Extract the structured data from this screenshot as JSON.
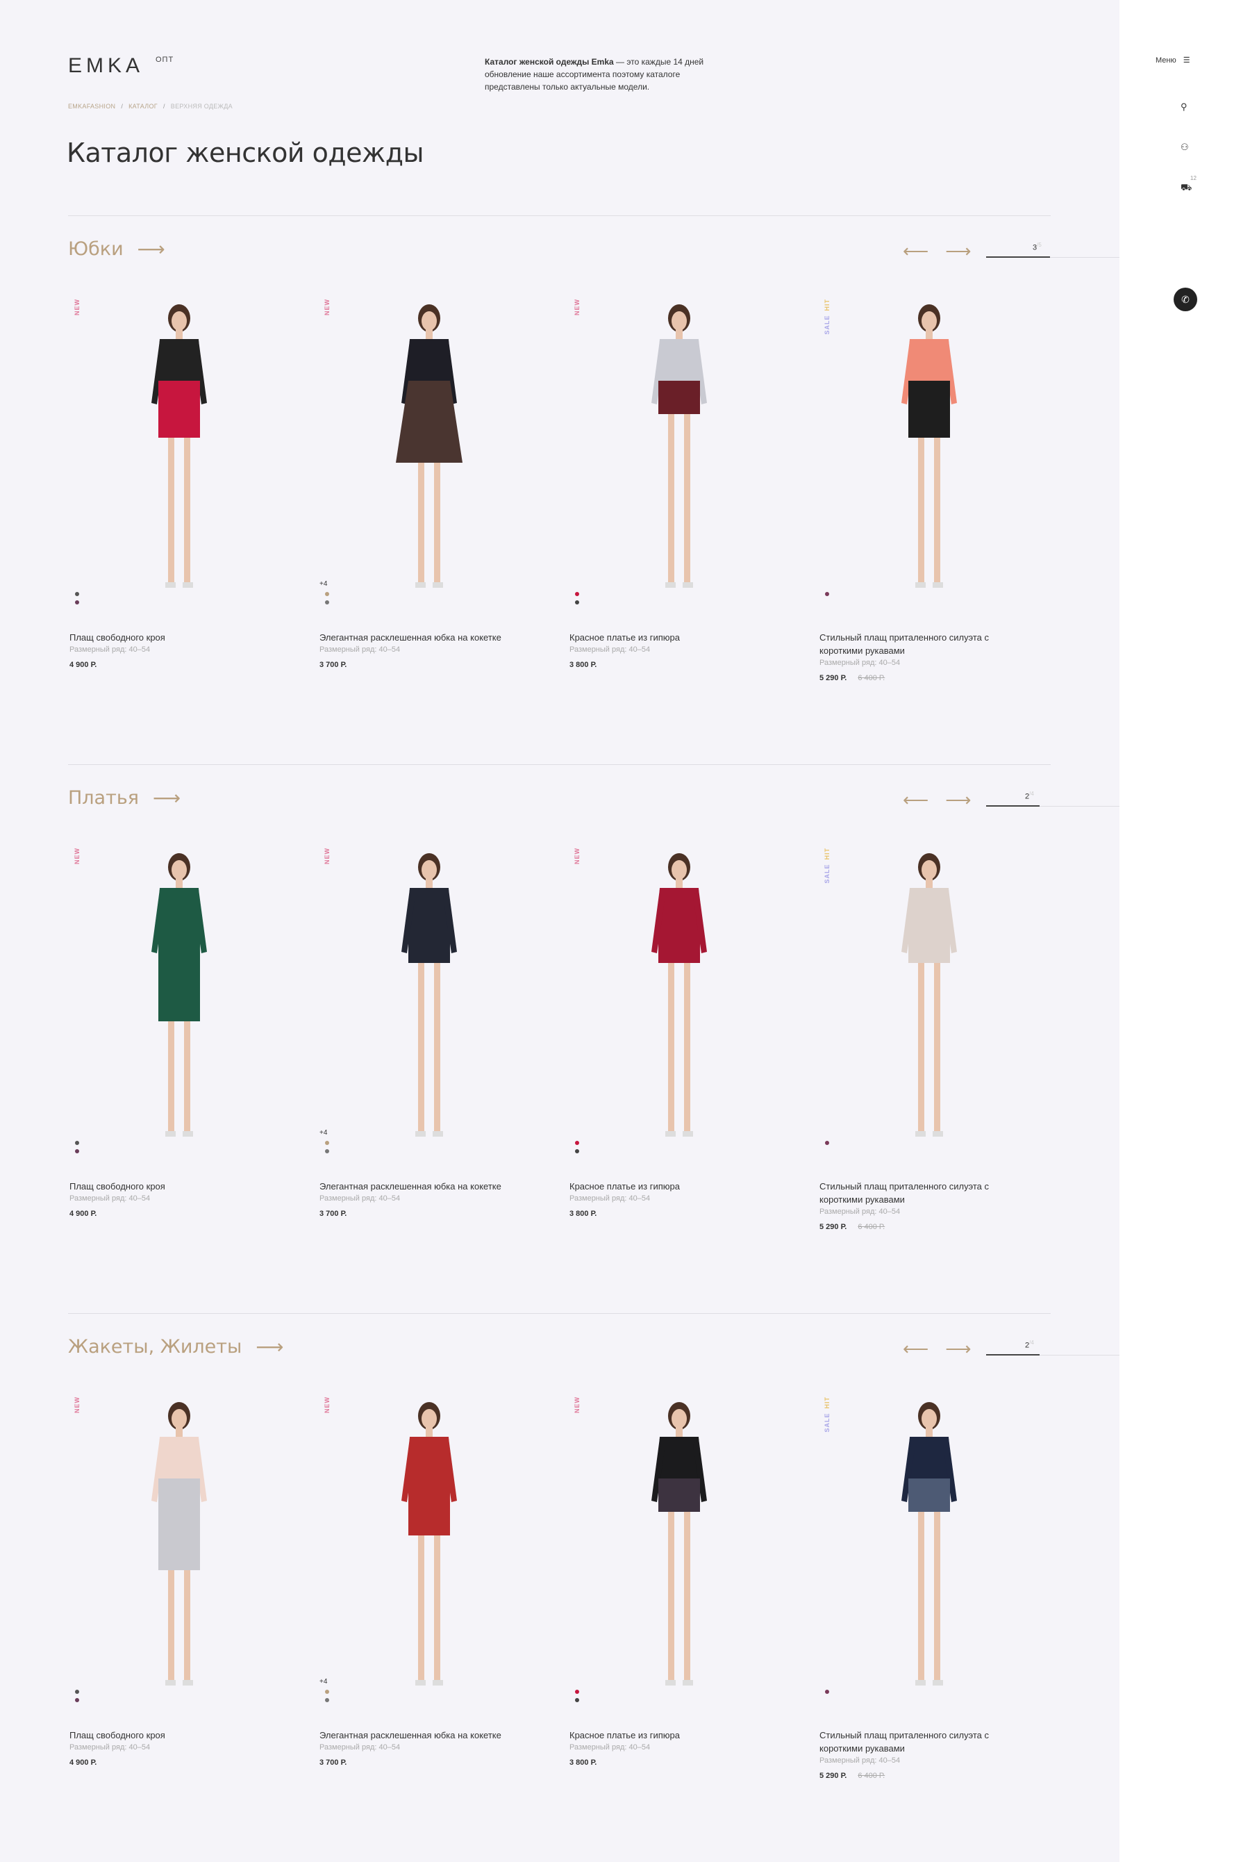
{
  "header": {
    "logo": "EMKA",
    "logo_sup": "ОПТ",
    "intro_bold": "Каталог женской одежды Emka",
    "intro_rest": " — это каждые 14 дней обновление наше ассортимента поэтому каталоге представлены только актуальные модели."
  },
  "breadcrumb": [
    "EMKAFASHION",
    "КАТАЛОГ",
    "ВЕРХНЯЯ ОДЕЖДА"
  ],
  "page_title": "Каталог женской одежды",
  "side": {
    "menu_label": "Меню",
    "cart_count": "12"
  },
  "sections": [
    {
      "title": "Юбки",
      "page": "3",
      "pages": "/5",
      "progress": 0.6,
      "items": [
        {
          "name": "Плащ свободного кроя",
          "size": "Размерный ряд: 40–54",
          "price": "4 900 Р.",
          "old": "",
          "badges": [
            "NEW"
          ],
          "more": "",
          "dots": [
            "#555",
            "#6a3d5a"
          ],
          "top": "#222",
          "bottom": "#c7163e",
          "bottom_len": "midi"
        },
        {
          "name": "Элегантная расклешенная юбка на кокетке",
          "size": "Размерный ряд: 40–54",
          "price": "3 700 Р.",
          "old": "",
          "badges": [
            "NEW"
          ],
          "more": "+4",
          "dots": [
            "#b9a07f",
            "#777"
          ],
          "top": "#1e1e26",
          "bottom": "#4a3530",
          "bottom_len": "flare"
        },
        {
          "name": "Красное платье из гипюра",
          "size": "Размерный ряд: 40–54",
          "price": "3 800 Р.",
          "old": "",
          "badges": [
            "NEW"
          ],
          "more": "",
          "dots": [
            "#c7163e",
            "#444"
          ],
          "top": "#c9cad2",
          "bottom": "#6a1f28",
          "bottom_len": "short"
        },
        {
          "name": "Стильный плащ приталенного силуэта с короткими рукавами",
          "size": "Размерный ряд: 40–54",
          "price": "5 290 Р.",
          "old": "6 400 Р.",
          "badges": [
            "SALE",
            "HIT"
          ],
          "more": "",
          "dots": [
            "#7a3a5a"
          ],
          "top": "#f08a76",
          "bottom": "#1e1e1e",
          "bottom_len": "midi"
        }
      ]
    },
    {
      "title": "Платья",
      "page": "2",
      "pages": "/4",
      "progress": 0.5,
      "items": [
        {
          "name": "Плащ свободного кроя",
          "size": "Размерный ряд: 40–54",
          "price": "4 900 Р.",
          "old": "",
          "badges": [
            "NEW"
          ],
          "more": "",
          "dots": [
            "#555",
            "#6a3d5a"
          ],
          "top": "#1e5a44",
          "bottom": "#1e5a44",
          "bottom_len": "long"
        },
        {
          "name": "Элегантная расклешенная юбка на кокетке",
          "size": "Размерный ряд: 40–54",
          "price": "3 700 Р.",
          "old": "",
          "badges": [
            "NEW"
          ],
          "more": "+4",
          "dots": [
            "#b9a07f",
            "#777"
          ],
          "top": "#232734",
          "bottom": "#232734",
          "bottom_len": "short"
        },
        {
          "name": "Красное платье из гипюра",
          "size": "Размерный ряд: 40–54",
          "price": "3 800 Р.",
          "old": "",
          "badges": [
            "NEW"
          ],
          "more": "",
          "dots": [
            "#c7163e",
            "#444"
          ],
          "top": "#a51733",
          "bottom": "#a51733",
          "bottom_len": "short"
        },
        {
          "name": "Стильный плащ приталенного силуэта с короткими рукавами",
          "size": "Размерный ряд: 40–54",
          "price": "5 290 Р.",
          "old": "6 400 Р.",
          "badges": [
            "SALE",
            "HIT"
          ],
          "more": "",
          "dots": [
            "#7a3a5a"
          ],
          "top": "#ddd2cc",
          "bottom": "#ddd2cc",
          "bottom_len": "short"
        }
      ]
    },
    {
      "title": "Жакеты, Жилеты",
      "page": "2",
      "pages": "/4",
      "progress": 0.5,
      "items": [
        {
          "name": "Плащ свободного кроя",
          "size": "Размерный ряд: 40–54",
          "price": "4 900 Р.",
          "old": "",
          "badges": [
            "NEW"
          ],
          "more": "",
          "dots": [
            "#555",
            "#6a3d5a"
          ],
          "top": "#efd6cc",
          "bottom": "#c9c9cf",
          "bottom_len": "long"
        },
        {
          "name": "Элегантная расклешенная юбка на кокетке",
          "size": "Размерный ряд: 40–54",
          "price": "3 700 Р.",
          "old": "",
          "badges": [
            "NEW"
          ],
          "more": "+4",
          "dots": [
            "#b9a07f",
            "#777"
          ],
          "top": "#b72c2c",
          "bottom": "#b72c2c",
          "bottom_len": "midi"
        },
        {
          "name": "Красное платье из гипюра",
          "size": "Размерный ряд: 40–54",
          "price": "3 800 Р.",
          "old": "",
          "badges": [
            "NEW"
          ],
          "more": "",
          "dots": [
            "#c7163e",
            "#444"
          ],
          "top": "#1b1b1d",
          "bottom": "#3d3340",
          "bottom_len": "short"
        },
        {
          "name": "Стильный плащ приталенного силуэта с короткими рукавами",
          "size": "Размерный ряд: 40–54",
          "price": "5 290 Р.",
          "old": "6 400 Р.",
          "badges": [
            "SALE",
            "HIT"
          ],
          "more": "",
          "dots": [
            "#7a3a5a"
          ],
          "top": "#1e2740",
          "bottom": "#4d5a74",
          "bottom_len": "short"
        }
      ]
    }
  ]
}
